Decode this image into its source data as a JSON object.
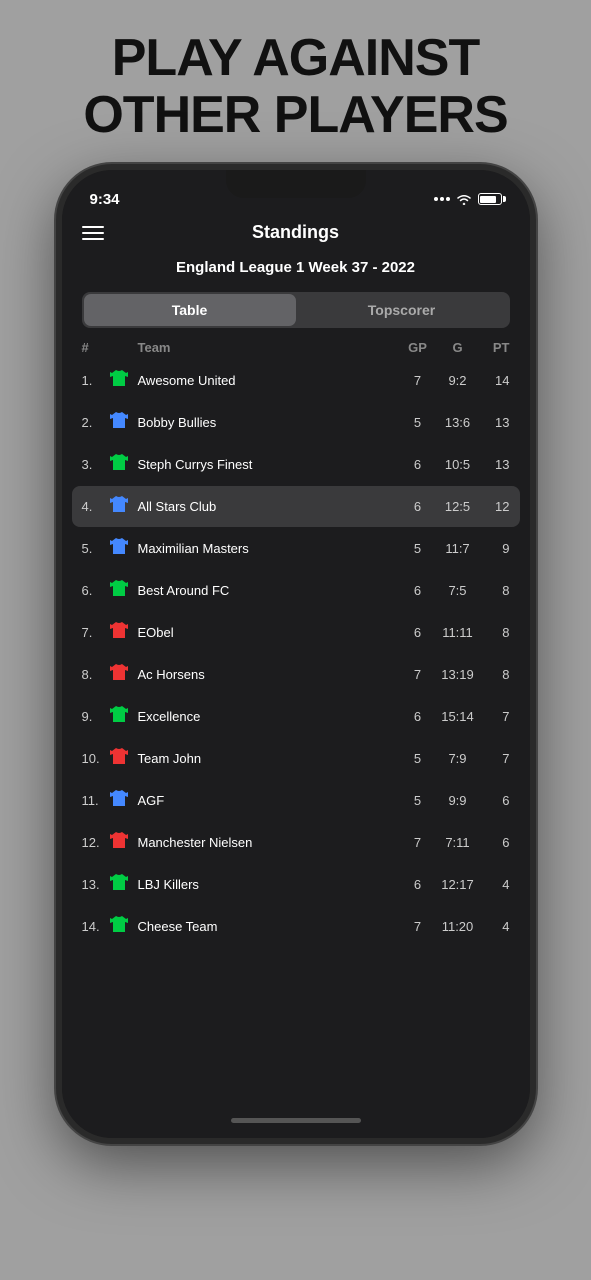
{
  "headline": {
    "line1": "PLAY AGAINST",
    "line2": "OTHER PLAYERS"
  },
  "status": {
    "time": "9:34"
  },
  "nav": {
    "title": "Standings"
  },
  "league": {
    "title": "England League 1 Week 37 - 2022"
  },
  "tabs": [
    {
      "label": "Table",
      "active": true
    },
    {
      "label": "Topscorer",
      "active": false
    }
  ],
  "table_headers": {
    "rank": "#",
    "team": "Team",
    "gp": "GP",
    "g": "G",
    "pt": "PT"
  },
  "teams": [
    {
      "rank": "1.",
      "jersey_color": "green",
      "name": "Awesome United",
      "gp": "7",
      "g": "9:2",
      "pt": "14",
      "highlighted": false
    },
    {
      "rank": "2.",
      "jersey_color": "blue",
      "name": "Bobby Bullies",
      "gp": "5",
      "g": "13:6",
      "pt": "13",
      "highlighted": false
    },
    {
      "rank": "3.",
      "jersey_color": "green",
      "name": "Steph Currys Finest",
      "gp": "6",
      "g": "10:5",
      "pt": "13",
      "highlighted": false
    },
    {
      "rank": "4.",
      "jersey_color": "blue",
      "name": "All Stars Club",
      "gp": "6",
      "g": "12:5",
      "pt": "12",
      "highlighted": true
    },
    {
      "rank": "5.",
      "jersey_color": "blue",
      "name": "Maximilian Masters",
      "gp": "5",
      "g": "11:7",
      "pt": "9",
      "highlighted": false
    },
    {
      "rank": "6.",
      "jersey_color": "green",
      "name": "Best Around FC",
      "gp": "6",
      "g": "7:5",
      "pt": "8",
      "highlighted": false
    },
    {
      "rank": "7.",
      "jersey_color": "red",
      "name": "EObel",
      "gp": "6",
      "g": "11:11",
      "pt": "8",
      "highlighted": false
    },
    {
      "rank": "8.",
      "jersey_color": "red",
      "name": "Ac Horsens",
      "gp": "7",
      "g": "13:19",
      "pt": "8",
      "highlighted": false
    },
    {
      "rank": "9.",
      "jersey_color": "green",
      "name": "Excellence",
      "gp": "6",
      "g": "15:14",
      "pt": "7",
      "highlighted": false
    },
    {
      "rank": "10.",
      "jersey_color": "red",
      "name": "Team John",
      "gp": "5",
      "g": "7:9",
      "pt": "7",
      "highlighted": false
    },
    {
      "rank": "11.",
      "jersey_color": "blue",
      "name": "AGF",
      "gp": "5",
      "g": "9:9",
      "pt": "6",
      "highlighted": false
    },
    {
      "rank": "12.",
      "jersey_color": "red",
      "name": "Manchester Nielsen",
      "gp": "7",
      "g": "7:11",
      "pt": "6",
      "highlighted": false
    },
    {
      "rank": "13.",
      "jersey_color": "green",
      "name": "LBJ Killers",
      "gp": "6",
      "g": "12:17",
      "pt": "4",
      "highlighted": false
    },
    {
      "rank": "14.",
      "jersey_color": "green",
      "name": "Cheese Team",
      "gp": "7",
      "g": "11:20",
      "pt": "4",
      "highlighted": false
    }
  ]
}
